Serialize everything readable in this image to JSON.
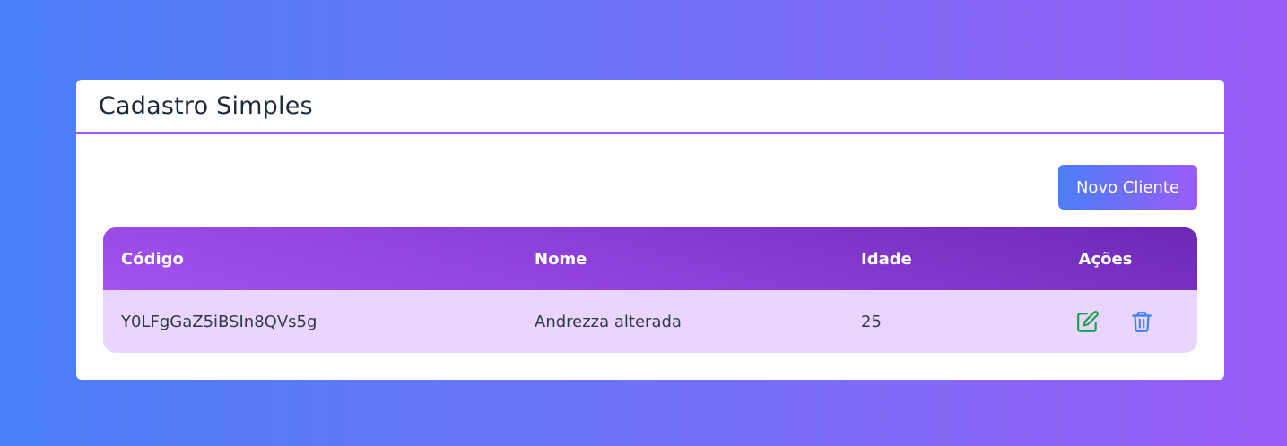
{
  "card": {
    "title": "Cadastro Simples"
  },
  "toolbar": {
    "new_label": "Novo Cliente"
  },
  "table": {
    "headers": [
      "Código",
      "Nome",
      "Idade",
      "Ações"
    ],
    "rows": [
      {
        "codigo": "Y0LFgGaZ5iBSIn8QVs5g",
        "nome": "Andrezza alterada",
        "idade": "25"
      }
    ]
  },
  "icons": {
    "edit": "edit-icon",
    "delete": "trash-icon"
  },
  "colors": {
    "accent_start": "#4a7ff7",
    "accent_end": "#9a5cf6",
    "header_purple": "#8a3fd8",
    "row_bg": "#e9d5ff",
    "edit_green": "#16a34a",
    "delete_blue": "#3b82f6"
  }
}
